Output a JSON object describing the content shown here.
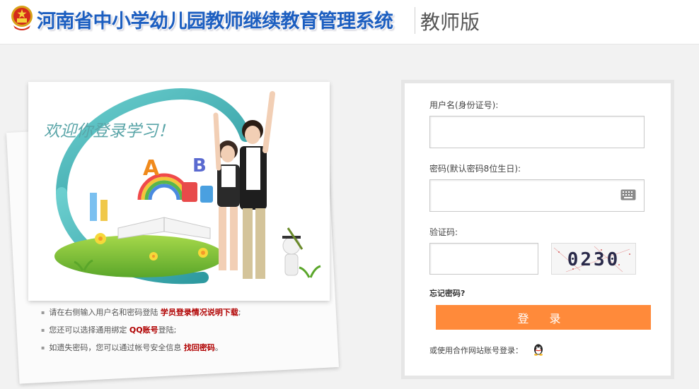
{
  "header": {
    "system_title": "河南省中小学幼儿园教师继续教育管理系统",
    "edition": "教师版"
  },
  "banner": {
    "welcome_text": "欢迎你登录学习！"
  },
  "tips": [
    {
      "text": "请在右侧输入用户名和密码登陆 ",
      "highlight": "学员登录情况说明下载",
      "suffix": ";"
    },
    {
      "text": "您还可以选择通用绑定 ",
      "highlight": "QQ账号",
      "suffix": "登陆;"
    },
    {
      "text": "如遗失密码，您可以通过帐号安全信息 ",
      "highlight": "找回密码",
      "suffix": "。"
    }
  ],
  "login": {
    "username_label": "用户名(身份证号):",
    "username_value": "",
    "password_label": "密码(默认密码8位生日):",
    "password_value": "",
    "captcha_label": "验证码:",
    "captcha_value": "",
    "captcha_image_text": "0230",
    "forgot_password": "忘记密码?",
    "login_button": "登 录",
    "partner_login": "或使用合作网站账号登录："
  },
  "icons": {
    "emblem": "national-emblem-icon",
    "keyboard": "keyboard-icon",
    "qq": "qq-penguin-icon"
  },
  "colors": {
    "title_blue": "#1c5ec0",
    "login_orange": "#ff8a3a",
    "tip_highlight": "#b00000"
  }
}
